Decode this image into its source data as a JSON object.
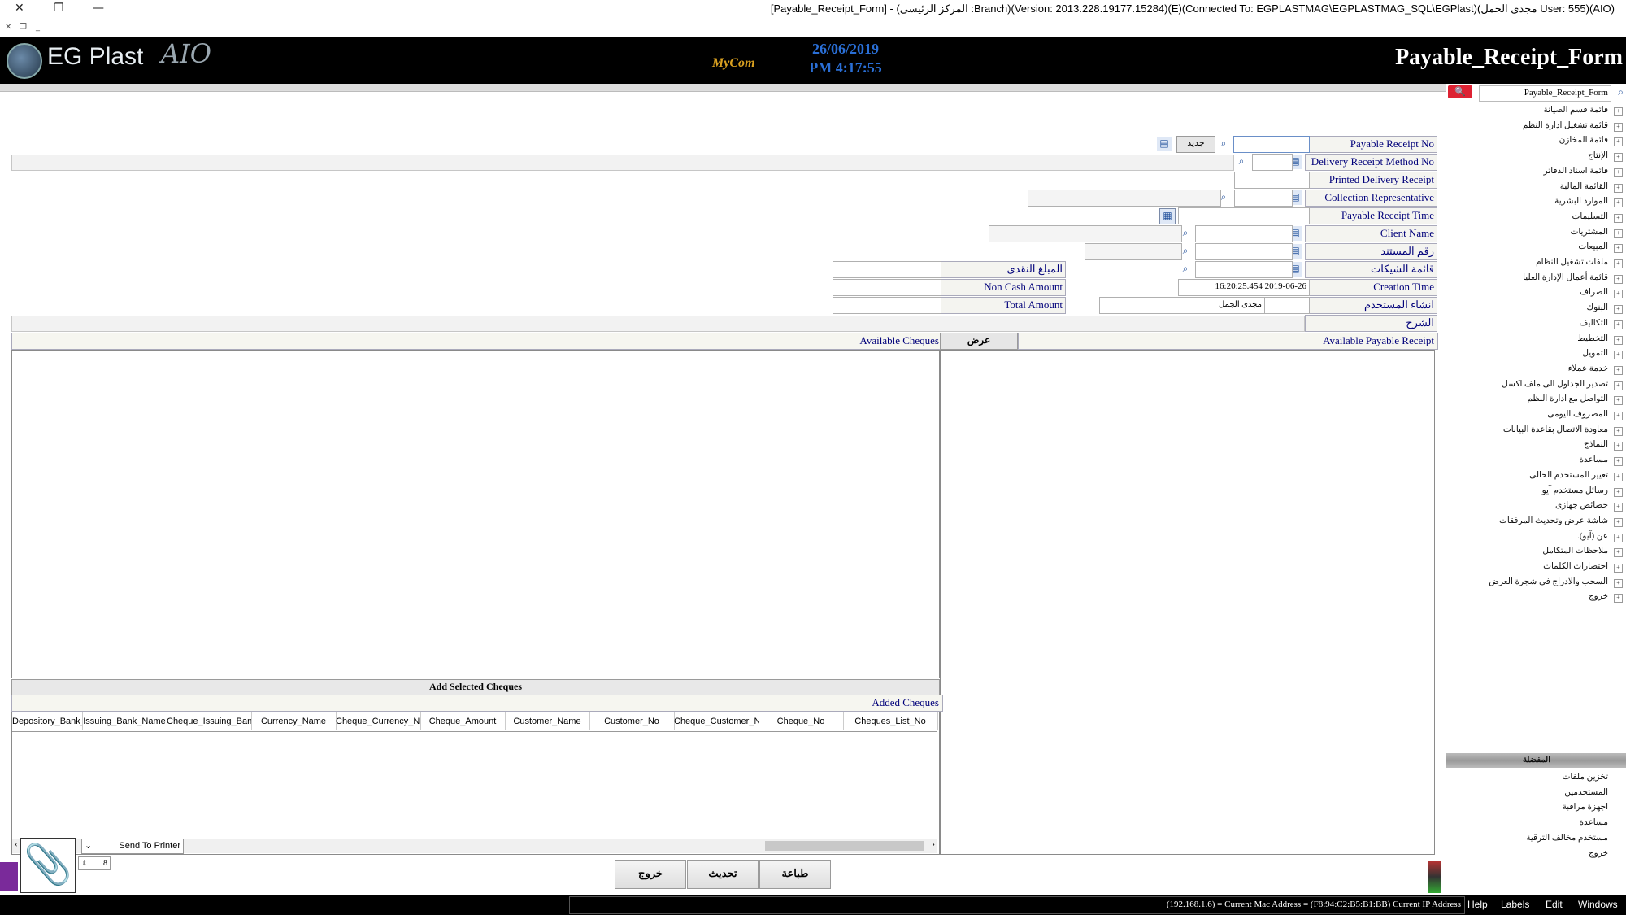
{
  "window": {
    "title": "[Payable_Receipt_Form] - (المركز الرئيسى :Branch)(Version: 2013.228.19177.15284)(E)(Connected To: EGPLASTMAG\\EGPLASTMAG_SQL\\EGPlast)(مجدى الجمل User: 555)(AIO)",
    "controls": {
      "close": "✕",
      "restore": "❐",
      "minimize": "—"
    }
  },
  "header": {
    "brand": "EG Plast",
    "brand_suffix": "AIO",
    "date": "26/06/2019",
    "time": "PM 4:17:55",
    "mini_logo": "MyCom",
    "form_title": "Payable_Receipt_Form"
  },
  "form": {
    "payable_receipt_no": {
      "label": "Payable Receipt No",
      "value": "",
      "new_button": "جديد"
    },
    "delivery_receipt_method_no": {
      "label": "Delivery Receipt Method No",
      "value": ""
    },
    "printed_delivery_receipt": {
      "label": "Printed Delivery Receipt",
      "value": ""
    },
    "collection_representative": {
      "label": "Collection Representative",
      "value": ""
    },
    "payable_receipt_time": {
      "label": "Payable Receipt Time",
      "value": ""
    },
    "client_name": {
      "label": "Client Name",
      "value": ""
    },
    "document_no": {
      "label": "رقم المستند",
      "value": ""
    },
    "cheques_list": {
      "label": "قائمة الشيكات",
      "value": ""
    },
    "cash_amount": {
      "label": "المبلغ النقدى",
      "value": ""
    },
    "non_cash_amount": {
      "label": "Non Cash Amount",
      "value": ""
    },
    "total_amount": {
      "label": "Total Amount",
      "value": ""
    },
    "creation_time": {
      "label": "Creation Time",
      "value": "16:20:25.454 2019-06-26"
    },
    "created_by": {
      "label": "انشاء المستخدم",
      "value": "مجدى الجمل"
    },
    "description": {
      "label": "الشرح",
      "value": ""
    }
  },
  "panes": {
    "available_cheques": "Available Cheques",
    "show_button": "عرض",
    "available_payable_receipt": "Available Payable Receipt",
    "add_selected_cheques": "Add Selected Cheques",
    "added_cheques": "Added Cheques",
    "columns": [
      "Depository_Bank_No",
      "Issuing_Bank_Name",
      "Cheque_Issuing_Bank_No",
      "Currency_Name",
      "Cheque_Currency_No",
      "Cheque_Amount",
      "Customer_Name",
      "Customer_No",
      "Cheque_Customer_No",
      "Cheque_No",
      "Cheques_List_No"
    ]
  },
  "printer": {
    "label": "Send To Printer",
    "copies": "8"
  },
  "buttons": {
    "exit": "خروج",
    "refresh": "تحديث",
    "print": "طباعة"
  },
  "tree": {
    "search_value": "Payable_Receipt_Form",
    "items": [
      "قائمة قسم الصيانة",
      "قائمة تشغيل ادارة النظم",
      "قائمة المخازن",
      "الإنتاج",
      "قائمة اسناد الدفاتر",
      "القائمة المالية",
      "الموارد البشرية",
      "التسليمات",
      "المشتريات",
      "المبيعات",
      "ملفات تشغيل النظام",
      "قائمة أعمال الإدارة العليا",
      "الصراف",
      "البنوك",
      "التكاليف",
      "التخطيط",
      "التمويل",
      "خدمة عملاء",
      "تصدير الجداول الى ملف اكسل",
      "التواصل مع ادارة النظم",
      "المصروف اليومى",
      "معاودة الاتصال بقاعدة البيانات",
      "النماذج",
      "مساعدة",
      "تغيير المستخدم الحالى",
      "رسائل مستخدم آيو",
      "خصائص جهازى",
      "شاشة عرض وتحديث المرفقات",
      "عن (آيو).",
      "ملاحظات المتكامل",
      "اختصارات الكلمات",
      "السحب والادراج فى شجرة العرض",
      "خروج"
    ],
    "favorites_title": "المفضلة",
    "favorites": [
      "تخزين ملفات",
      "المستخدمين",
      "اجهزة مراقبة",
      "مساعدة",
      "مستخدم مخالف الترقية",
      "خروج"
    ]
  },
  "status": {
    "network": "(192.168.1.6) = Current Mac Address = (F8:94:C2:B5:B1:BB) Current IP Address",
    "menu": [
      "Help",
      "Labels",
      "Edit",
      "Windows"
    ]
  },
  "colors": {
    "accent_blue": "#2a6fd6",
    "label_text": "#00007a",
    "header_bg": "#000000"
  }
}
